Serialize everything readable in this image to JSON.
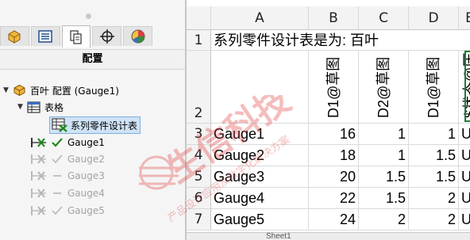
{
  "panel": {
    "title": "配置",
    "tabs": [
      {
        "icon": "part-features-icon",
        "color": "#e8a634"
      },
      {
        "icon": "property-manager-icon",
        "color": "#1f4e8c"
      },
      {
        "icon": "configuration-manager-icon",
        "color": "#444444"
      },
      {
        "icon": "dimxpert-icon",
        "color": "#333333"
      },
      {
        "icon": "display-manager-icon",
        "color": "#d04040"
      }
    ],
    "tree": {
      "root_label": "百叶 配置 (Gauge1)",
      "tables_label": "表格",
      "design_table_label": "系列零件设计表",
      "configs": [
        {
          "label": "Gauge1",
          "active": true
        },
        {
          "label": "Gauge2",
          "active": false
        },
        {
          "label": "Gauge3",
          "active": false
        },
        {
          "label": "Gauge4",
          "active": false
        },
        {
          "label": "Gauge5",
          "active": false
        }
      ]
    }
  },
  "sheet": {
    "columns": [
      "A",
      "B",
      "C",
      "D",
      "E"
    ],
    "row_numbers": [
      "1",
      "2",
      "3",
      "4",
      "5",
      "6",
      "7"
    ],
    "title_cell": "系列零件设计表是为:   百叶",
    "headers": [
      "D1@草图",
      "D2@草图",
      "D1@草图",
      "$状态@压"
    ],
    "rows": [
      {
        "name": "Gauge1",
        "b": "16",
        "c": "1",
        "d": "1",
        "e": "U"
      },
      {
        "name": "Gauge2",
        "b": "18",
        "c": "1",
        "d": "1.5",
        "e": "U"
      },
      {
        "name": "Gauge3",
        "b": "20",
        "c": "1.5",
        "d": "1.5",
        "e": "U"
      },
      {
        "name": "Gauge4",
        "b": "22",
        "c": "1.5",
        "d": "2",
        "e": "U"
      },
      {
        "name": "Gauge5",
        "b": "24",
        "c": "2",
        "d": "2",
        "e": "U"
      }
    ],
    "sheet_tab": "Sheet1"
  },
  "watermark": {
    "main": "生信科技",
    "sub": "产品设计应用及数字化解决方案"
  },
  "colors": {
    "accent": "#2b78c2",
    "watermark": "#e23a3a",
    "check": "#1c8b1c"
  }
}
